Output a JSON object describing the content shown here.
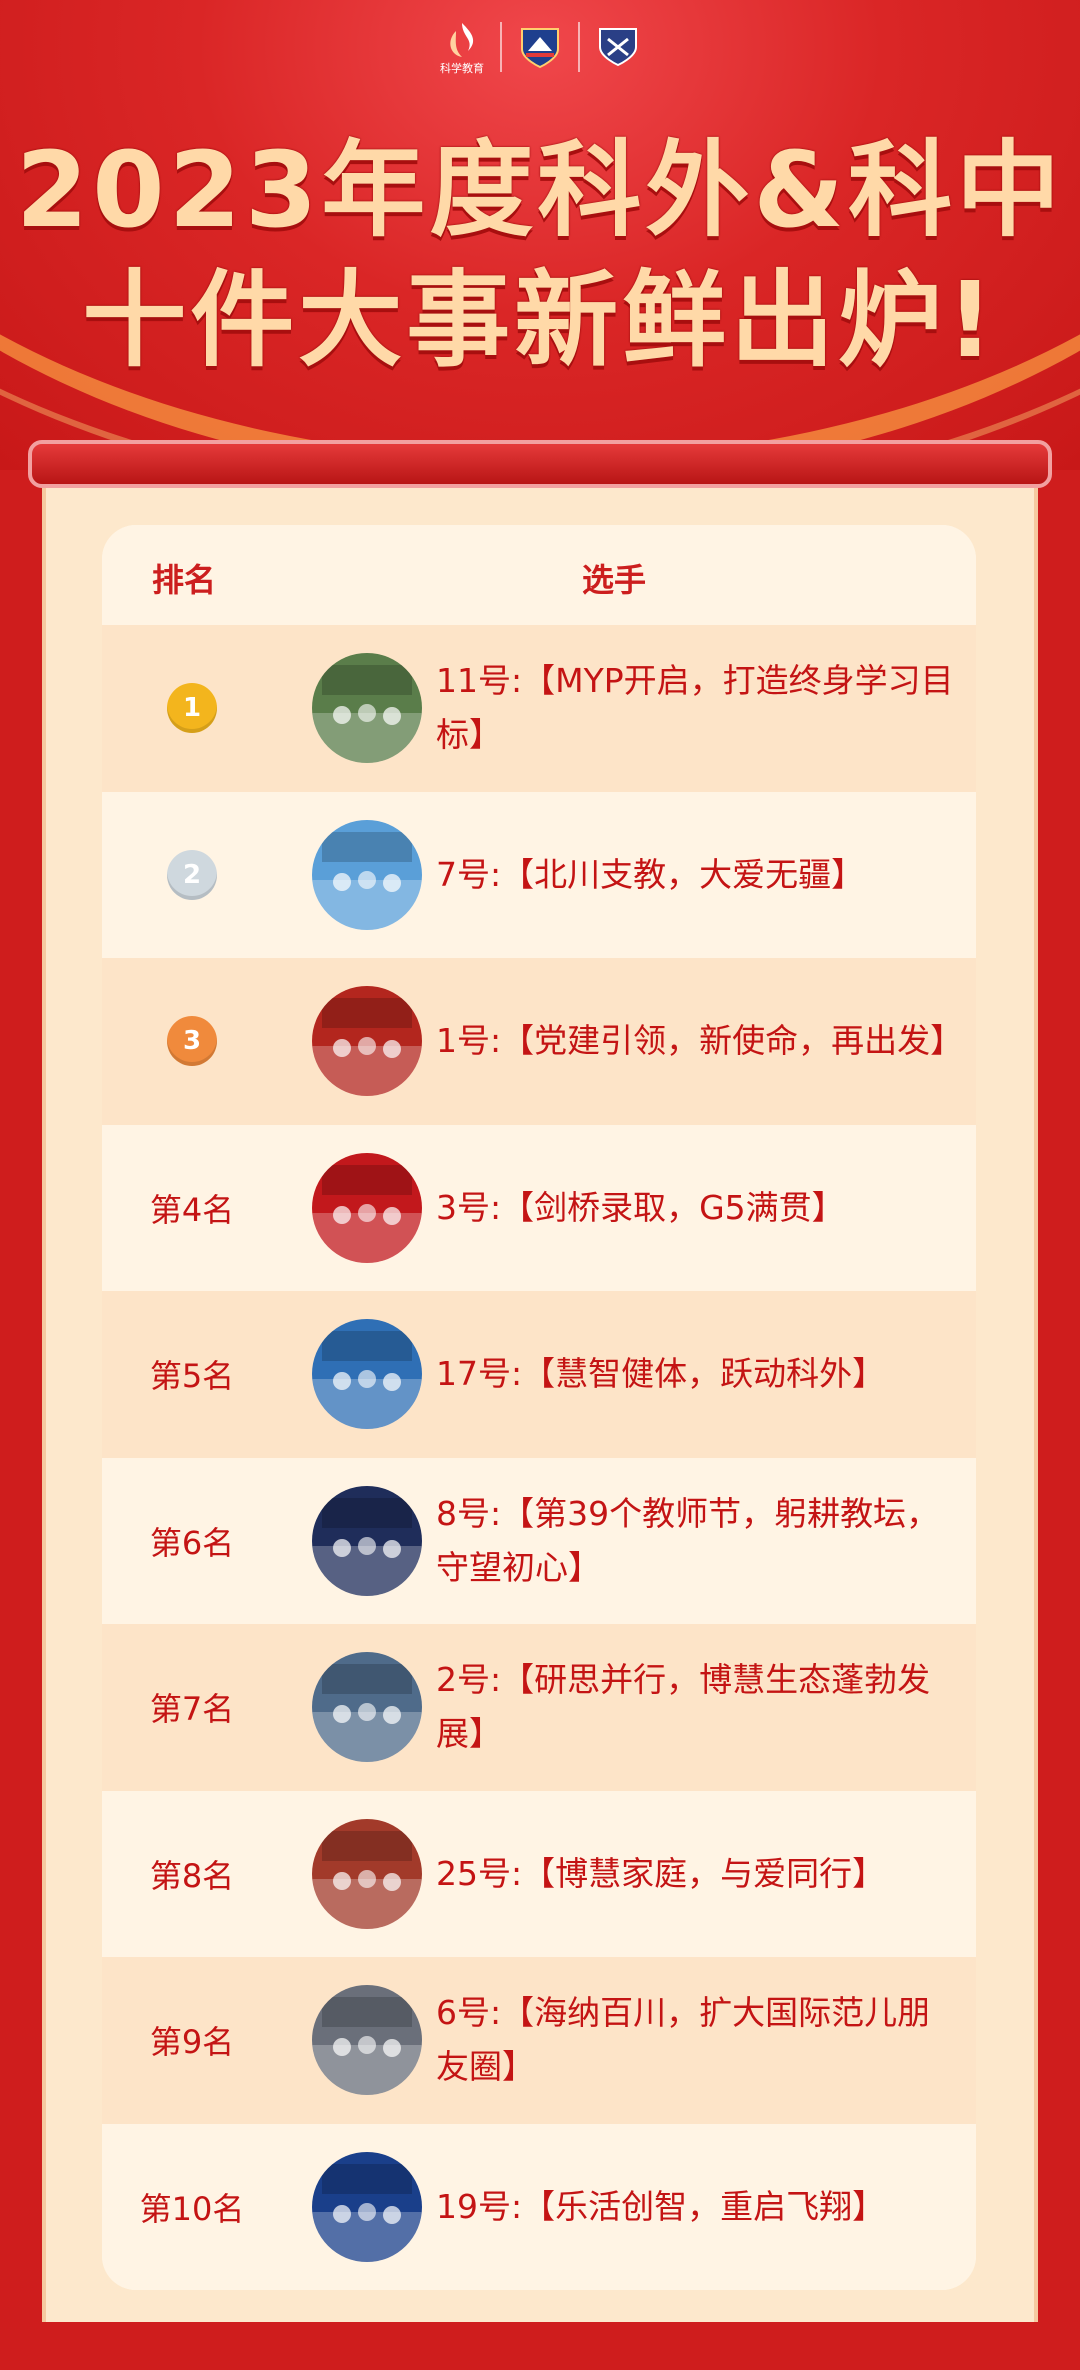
{
  "header": {
    "logos": [
      {
        "name": "school-logo-1",
        "text": "科学教育"
      },
      {
        "name": "school-logo-2",
        "text": ""
      },
      {
        "name": "school-logo-3",
        "text": ""
      }
    ],
    "title_line1": "2023年度科外&科中",
    "title_line2": "十件大事新鲜出炉!"
  },
  "table": {
    "col_rank": "排名",
    "col_player": "选手",
    "rows": [
      {
        "rank": "1",
        "medal": "gold",
        "entry": "11号:【MYP开启，打造终身学习目标】",
        "thumb_color": "#5a7d4a"
      },
      {
        "rank": "2",
        "medal": "silver",
        "entry": "7号:【北川支教，大爱无疆】",
        "thumb_color": "#5a9fd8"
      },
      {
        "rank": "3",
        "medal": "bronze",
        "entry": "1号:【党建引领，新使命，再出发】",
        "thumb_color": "#b3261e"
      },
      {
        "rank": "第4名",
        "medal": "",
        "entry": "3号:【剑桥录取，G5满贯】",
        "thumb_color": "#c2181c"
      },
      {
        "rank": "第5名",
        "medal": "",
        "entry": "17号:【慧智健体，跃动科外】",
        "thumb_color": "#2f6fb5"
      },
      {
        "rank": "第6名",
        "medal": "",
        "entry": "8号:【第39个教师节，躬耕教坛，守望初心】",
        "thumb_color": "#1f2d5a"
      },
      {
        "rank": "第7名",
        "medal": "",
        "entry": "2号:【研思并行，博慧生态蓬勃发展】",
        "thumb_color": "#4f6b8a"
      },
      {
        "rank": "第8名",
        "medal": "",
        "entry": "25号:【博慧家庭，与爱同行】",
        "thumb_color": "#a23a2a"
      },
      {
        "rank": "第9名",
        "medal": "",
        "entry": "6号:【海纳百川，扩大国际范儿朋友圈】",
        "thumb_color": "#6a6f7a"
      },
      {
        "rank": "第10名",
        "medal": "",
        "entry": "19号:【乐活创智，重启飞翔】",
        "thumb_color": "#1a3f8a"
      }
    ]
  },
  "colors": {
    "background": "#cf1d1d",
    "paper": "#fde8cc",
    "text": "#c41414",
    "gold": "#f3b51d",
    "silver": "#cfd8de",
    "bronze": "#f08a3c"
  }
}
